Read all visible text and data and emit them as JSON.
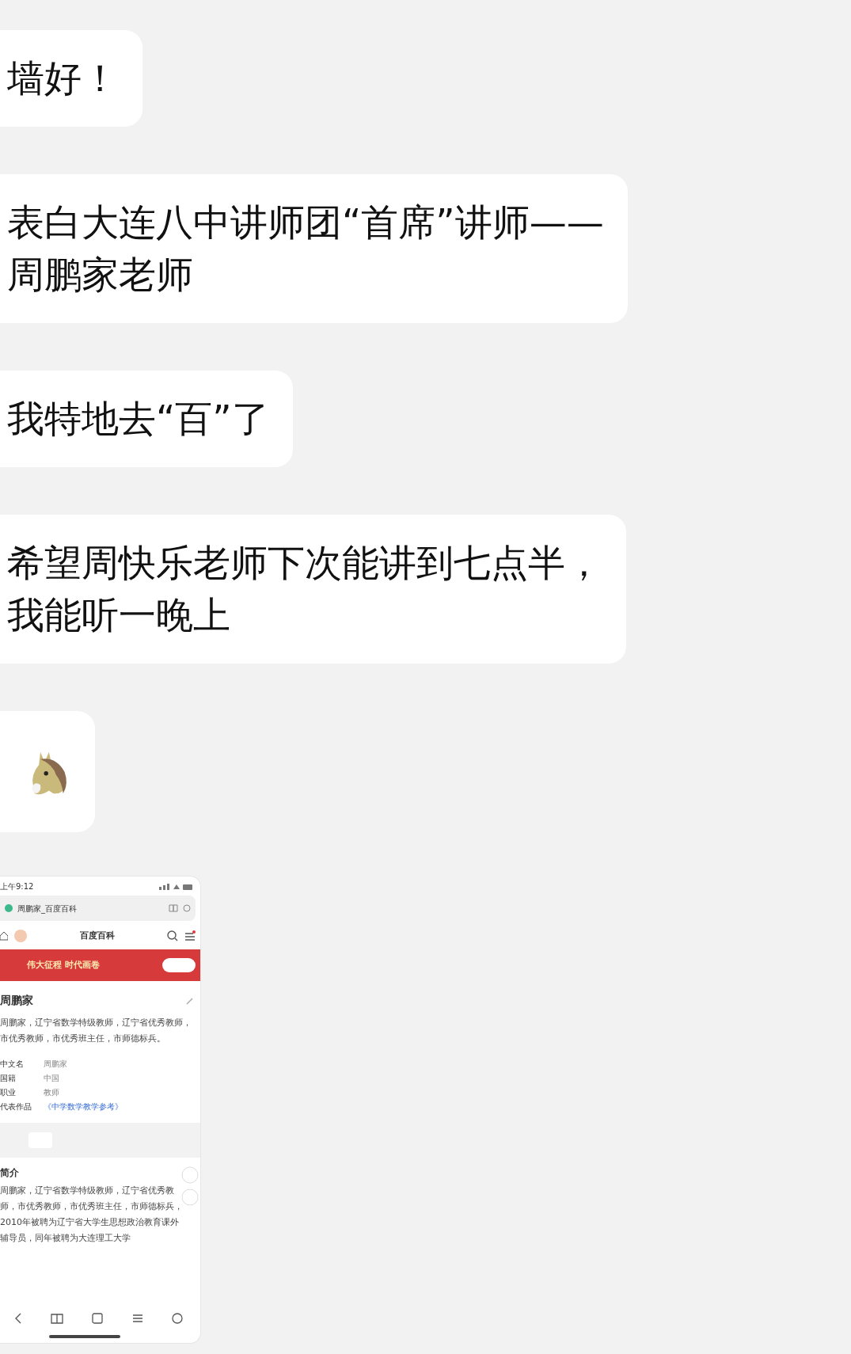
{
  "messages": [
    {
      "kind": "text",
      "text": "墙好！"
    },
    {
      "kind": "lines",
      "lines": [
        "表白大连八中讲师团“首席”讲师——",
        "周鹏家老师"
      ]
    },
    {
      "kind": "text",
      "text": "我特地去“百”了"
    },
    {
      "kind": "lines",
      "lines": [
        "希望周快乐老师下次能讲到七点半，",
        "我能听一晚上"
      ]
    },
    {
      "kind": "emoji"
    },
    {
      "kind": "screenshot",
      "screen": {
        "status_time": "上午9:12",
        "tab_title": "周鹏家_百度百科",
        "site_title": "百度百科",
        "banner_title": "伟大征程 时代画卷",
        "entry_title": "周鹏家",
        "summary": "周鹏家，辽宁省数学特级教师，辽宁省优秀教师，市优秀教师，市优秀班主任，市师德标兵。",
        "infobox": [
          {
            "label": "中文名",
            "value": "周鹏家"
          },
          {
            "label": "国籍",
            "value": "中国"
          },
          {
            "label": "职业",
            "value": "教师"
          },
          {
            "label": "代表作品",
            "value": "《中学数学教学参考》"
          }
        ],
        "section_title": "简介",
        "section_text": "周鹏家，辽宁省数学特级教师，辽宁省优秀教师，市优秀教师，市优秀班主任，市师德标兵，2010年被聘为辽宁省大学生思想政治教育课外辅导员，同年被聘为大连理工大学"
      }
    }
  ]
}
